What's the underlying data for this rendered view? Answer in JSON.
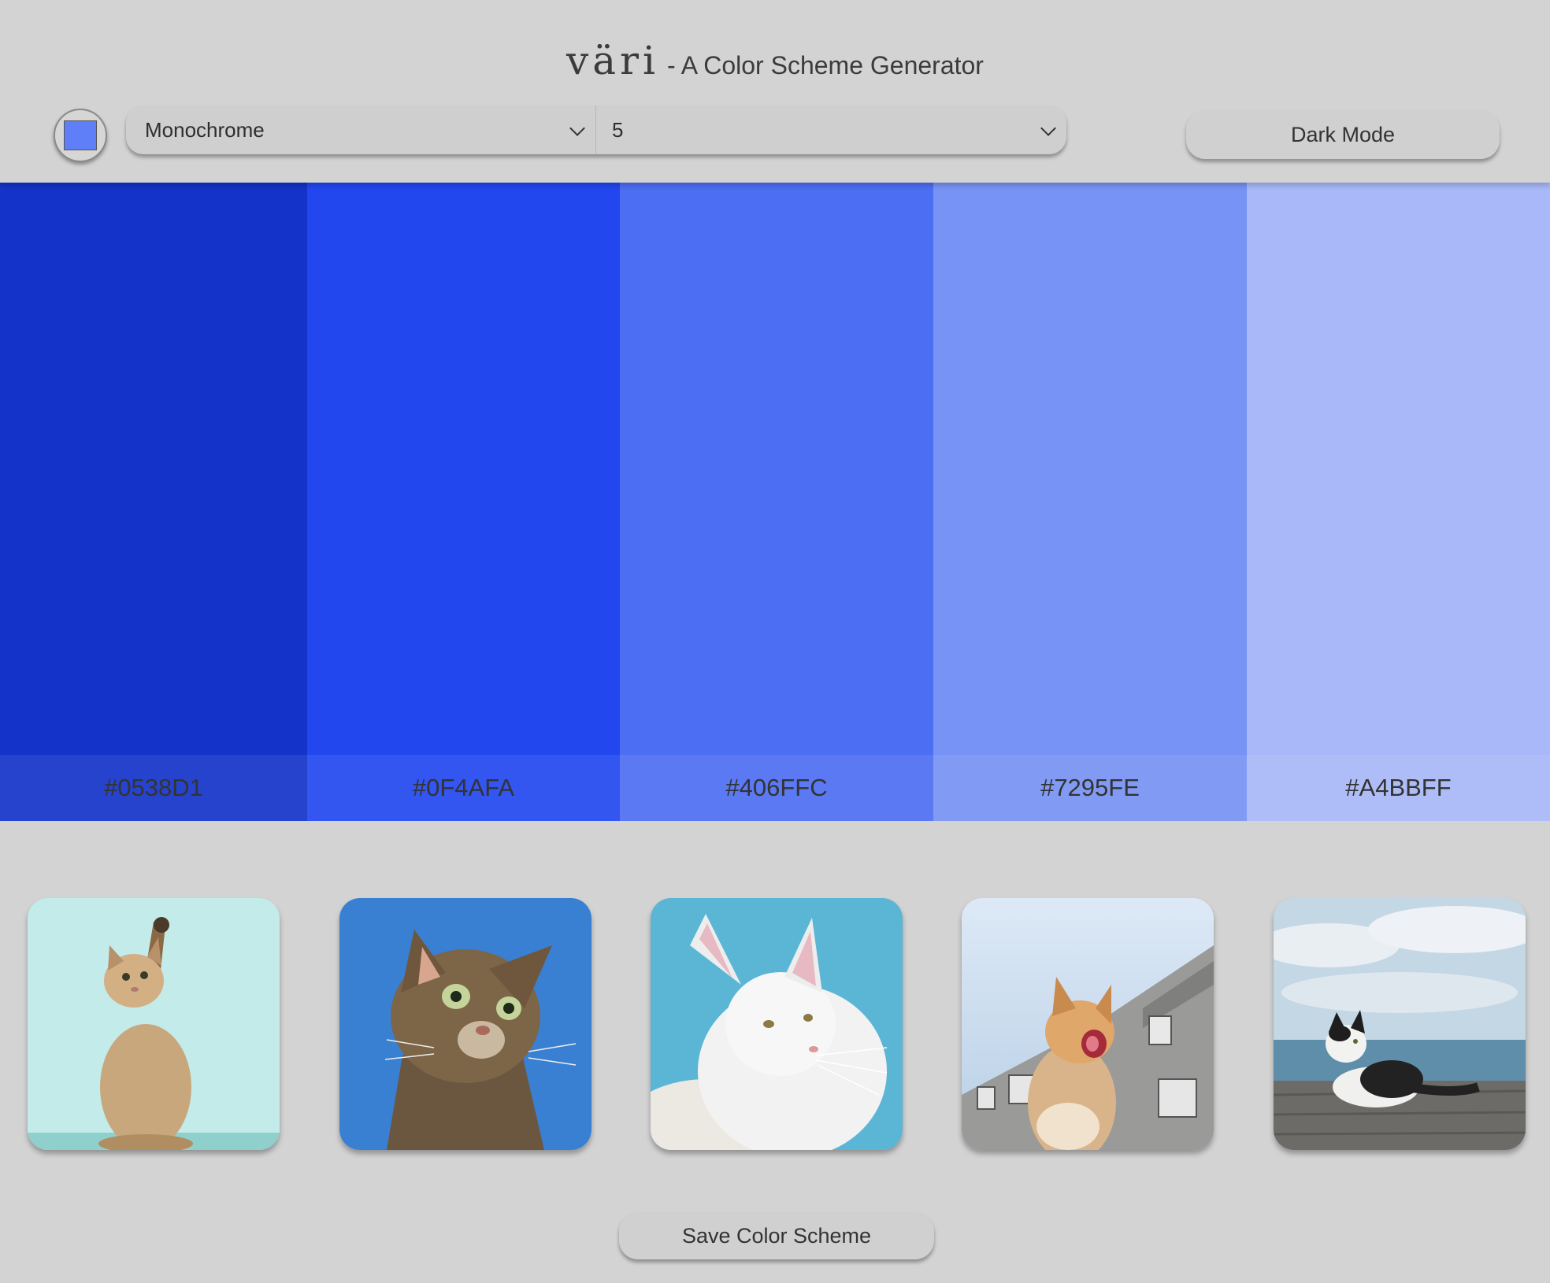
{
  "header": {
    "logo": "väri",
    "subtitle": "- A Color Scheme Generator",
    "seed_color": "#5f7ff8",
    "scheme_select": {
      "selected": "Monochrome"
    },
    "count_select": {
      "selected": "5"
    },
    "dark_mode_label": "Dark Mode"
  },
  "palette": {
    "colors": [
      {
        "hex": "#0538D1",
        "display": "#1433c9"
      },
      {
        "hex": "#0F4AFA",
        "display": "#2247ef"
      },
      {
        "hex": "#406FFC",
        "display": "#4c6ef2"
      },
      {
        "hex": "#7295FE",
        "display": "#7793f5"
      },
      {
        "hex": "#A4BBFF",
        "display": "#a8b8f8"
      }
    ]
  },
  "cats": [
    {
      "icon": "cat-photo-kitten-reaching",
      "bg": "#bfe9ea"
    },
    {
      "icon": "cat-photo-tabby-looking-up",
      "bg": "#3a7fd0"
    },
    {
      "icon": "cat-photo-white-longhair",
      "bg": "#5ab6d6"
    },
    {
      "icon": "cat-photo-orange-cat-yawning",
      "bg": "#c7d9ec"
    },
    {
      "icon": "cat-photo-black-white-cat-by-sea",
      "bg": "#c9d9e6"
    }
  ],
  "footer": {
    "save_label": "Save Color Scheme"
  }
}
